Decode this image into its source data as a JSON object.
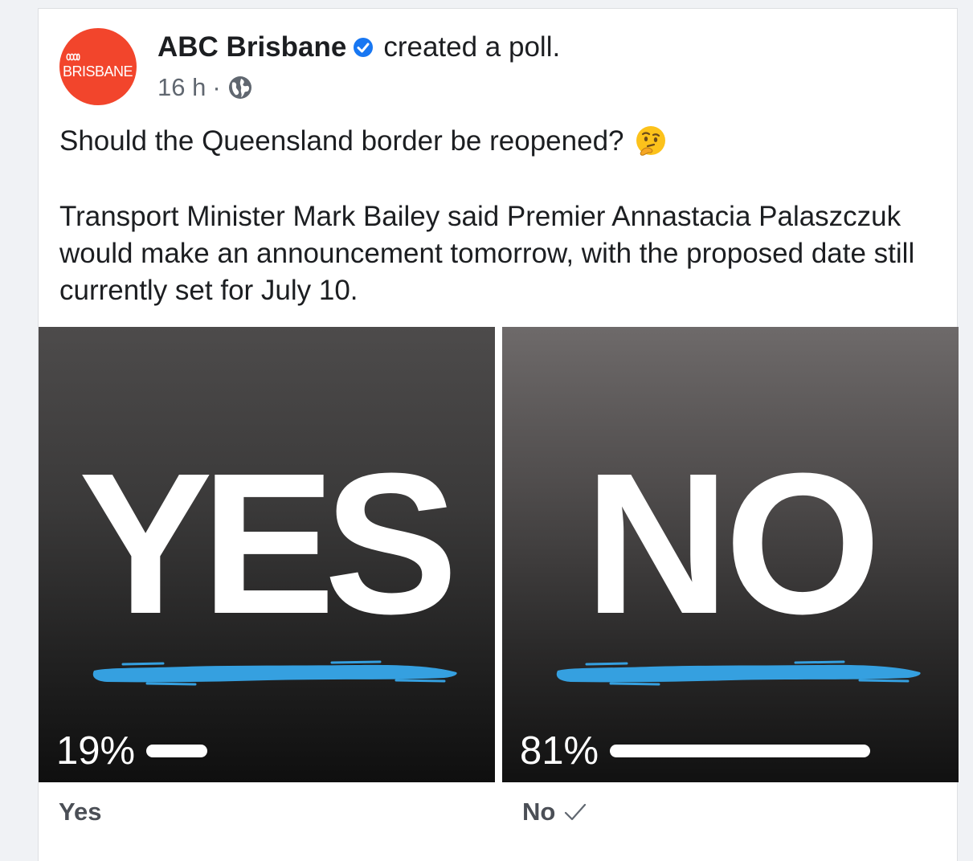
{
  "post": {
    "page_name": "ABC Brisbane",
    "action": "created a poll.",
    "time": "16 h",
    "dot": "·",
    "avatar_text": "BRISBANE",
    "question": "Should the Queensland border be reopened?",
    "body": "Transport Minister Mark Bailey said Premier Annastacia Palaszczuk would make an announcement tomorrow, with the proposed date still currently set for July 10."
  },
  "poll": {
    "options": [
      {
        "word": "YES",
        "percent_text": "19%",
        "fraction": 0.19,
        "label": "Yes",
        "selected": false
      },
      {
        "word": "NO",
        "percent_text": "81%",
        "fraction": 0.81,
        "label": "No",
        "selected": true
      }
    ]
  },
  "icons": {
    "verified": "verified-badge-icon",
    "audience": "globe-icon",
    "emoji": "thinking-face-emoji",
    "selected": "check-icon"
  },
  "colors": {
    "brand": "#f2452c",
    "verified": "#1877f2",
    "brush": "#35a0e0"
  }
}
